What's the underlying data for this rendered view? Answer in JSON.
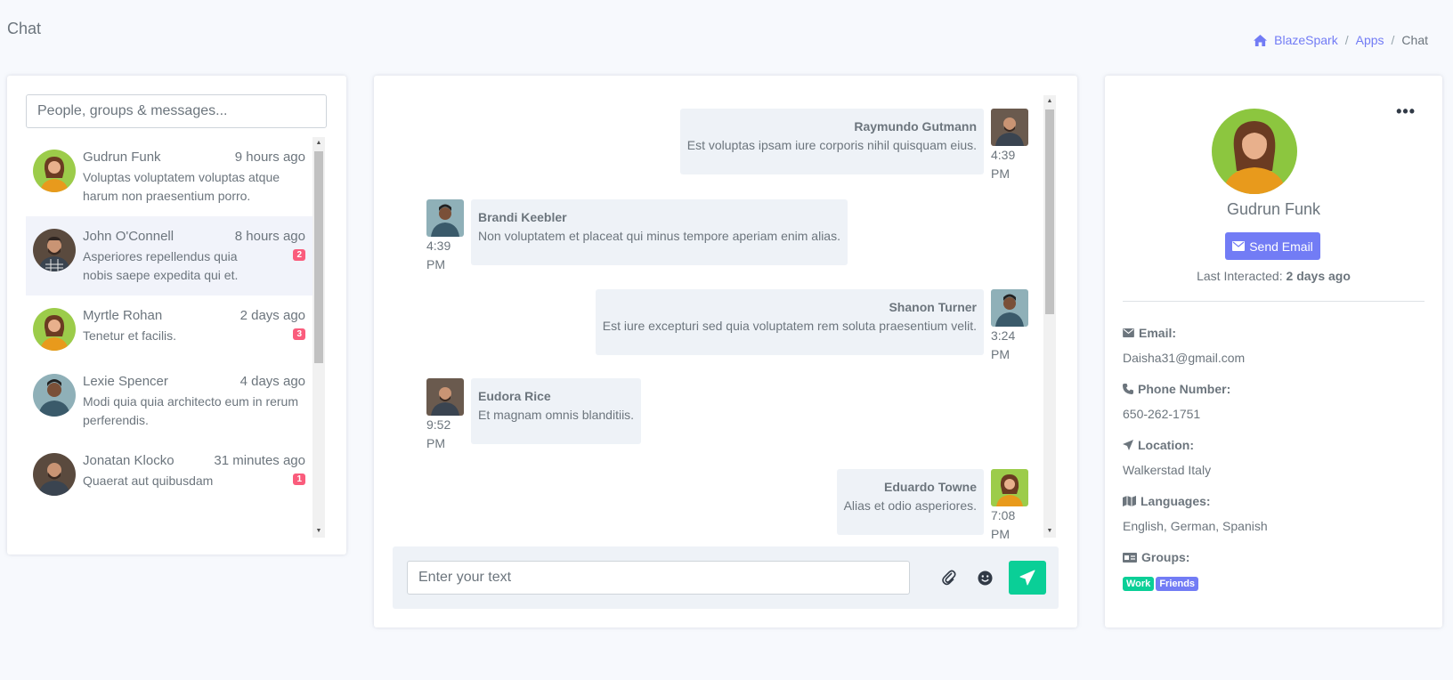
{
  "page": {
    "title": "Chat"
  },
  "breadcrumb": {
    "home": "BlazeSpark",
    "section": "Apps",
    "current": "Chat",
    "sep": "/"
  },
  "contacts": {
    "search_placeholder": "People, groups & messages...",
    "items": [
      {
        "name": "Gudrun Funk",
        "time": "9 hours ago",
        "message": "Voluptas voluptatem voluptas atque harum non praesentium porro.",
        "unread": ""
      },
      {
        "name": "John O'Connell",
        "time": "8 hours ago",
        "message": "Asperiores repellendus quia nobis saepe expedita qui et.",
        "unread": "2"
      },
      {
        "name": "Myrtle Rohan",
        "time": "2 days ago",
        "message": "Tenetur et facilis.",
        "unread": "3"
      },
      {
        "name": "Lexie Spencer",
        "time": "4 days ago",
        "message": "Modi quia quia architecto eum in rerum perferendis.",
        "unread": ""
      },
      {
        "name": "Jonatan Klocko",
        "time": "31 minutes ago",
        "message": "Quaerat aut quibusdam",
        "unread": "1"
      }
    ]
  },
  "conversation": {
    "messages": [
      {
        "author": "Raymundo Gutmann",
        "text": "Est voluptas ipsam iure corporis nihil quisquam eius.",
        "time": "4:39",
        "ampm": "PM",
        "side": "right"
      },
      {
        "author": "Brandi Keebler",
        "text": "Non voluptatem et placeat qui minus tempore aperiam enim alias.",
        "time": "4:39",
        "ampm": "PM",
        "side": "left"
      },
      {
        "author": "Shanon Turner",
        "text": "Est iure excepturi sed quia voluptatem rem soluta praesentium velit.",
        "time": "3:24",
        "ampm": "PM",
        "side": "right"
      },
      {
        "author": "Eudora Rice",
        "text": "Et magnam omnis blanditiis.",
        "time": "9:52",
        "ampm": "PM",
        "side": "left"
      },
      {
        "author": "Eduardo Towne",
        "text": "Alias et odio asperiores.",
        "time": "7:08",
        "ampm": "PM",
        "side": "right"
      }
    ],
    "input_placeholder": "Enter your text"
  },
  "profile": {
    "name": "Gudrun Funk",
    "email_button": "Send Email",
    "last_interacted_label": "Last Interacted:",
    "last_interacted_value": "2 days ago",
    "email_label": "Email:",
    "email": "Daisha31@gmail.com",
    "phone_label": "Phone Number:",
    "phone": "650-262-1751",
    "location_label": "Location:",
    "location": "Walkerstad Italy",
    "languages_label": "Languages:",
    "languages": "English, German, Spanish",
    "groups_label": "Groups:",
    "groups": [
      "Work",
      "Friends"
    ],
    "more": "•••"
  },
  "colors": {
    "primary": "#727cf5",
    "success": "#0acf97",
    "danger": "#fa5c7c",
    "light_bg": "#eef2f7"
  },
  "icons": [
    "home-icon",
    "paperclip-icon",
    "smile-icon",
    "send-icon",
    "envelope-icon",
    "phone-icon",
    "location-icon",
    "map-icon",
    "id-card-icon",
    "more-icon"
  ]
}
